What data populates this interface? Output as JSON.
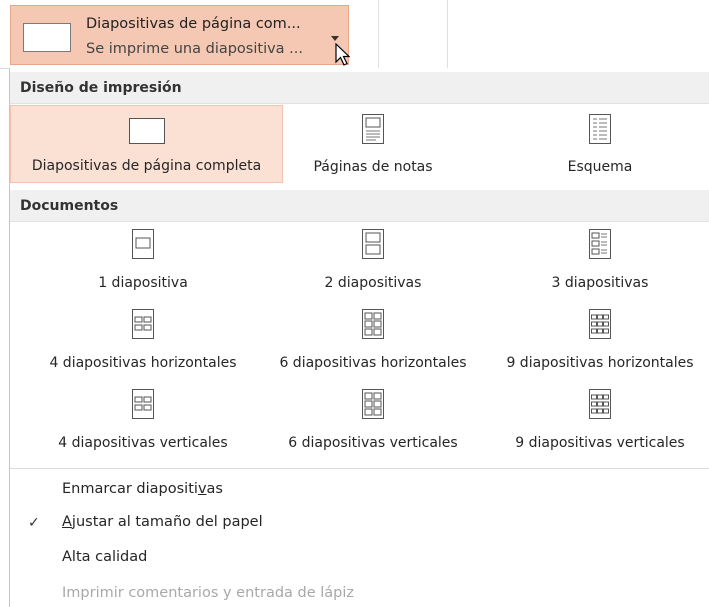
{
  "dropdown": {
    "title": "Diapositivas de página com...",
    "subtitle": "Se imprime una diapositiva ..."
  },
  "print_layout": {
    "header": "Diseño de impresión",
    "items": [
      {
        "label": "Diapositivas de página completa",
        "icon": "full-page-slide-icon",
        "selected": true
      },
      {
        "label": "Páginas de notas",
        "icon": "notes-page-icon",
        "selected": false
      },
      {
        "label": "Esquema",
        "icon": "outline-icon",
        "selected": false
      }
    ]
  },
  "handouts": {
    "header": "Documentos",
    "items": [
      {
        "label": "1 diapositiva",
        "icon": "handout-1-slide-icon"
      },
      {
        "label": "2 diapositivas",
        "icon": "handout-2-slides-icon"
      },
      {
        "label": "3 diapositivas",
        "icon": "handout-3-slides-icon"
      },
      {
        "label": "4 diapositivas horizontales",
        "icon": "handout-4-horizontal-icon"
      },
      {
        "label": "6 diapositivas horizontales",
        "icon": "handout-6-horizontal-icon"
      },
      {
        "label": "9 diapositivas horizontales",
        "icon": "handout-9-horizontal-icon"
      },
      {
        "label": "4 diapositivas verticales",
        "icon": "handout-4-vertical-icon"
      },
      {
        "label": "6 diapositivas verticales",
        "icon": "handout-6-vertical-icon"
      },
      {
        "label": "9 diapositivas verticales",
        "icon": "handout-9-vertical-icon"
      }
    ]
  },
  "options": {
    "frame_pre": "Enmarcar diapositi",
    "frame_key": "v",
    "frame_post": "as",
    "fit_key": "A",
    "fit_post": "justar al tamaño del papel",
    "fit_checked": true,
    "check_mark": "✓",
    "high_quality": "Alta calidad",
    "comments": "Imprimir comentarios y entrada de lápiz",
    "comments_enabled": false
  },
  "colors": {
    "selected_bg": "#fbe0d4",
    "button_bg": "#f4c8b3",
    "section_bg": "#f0f0f0"
  }
}
